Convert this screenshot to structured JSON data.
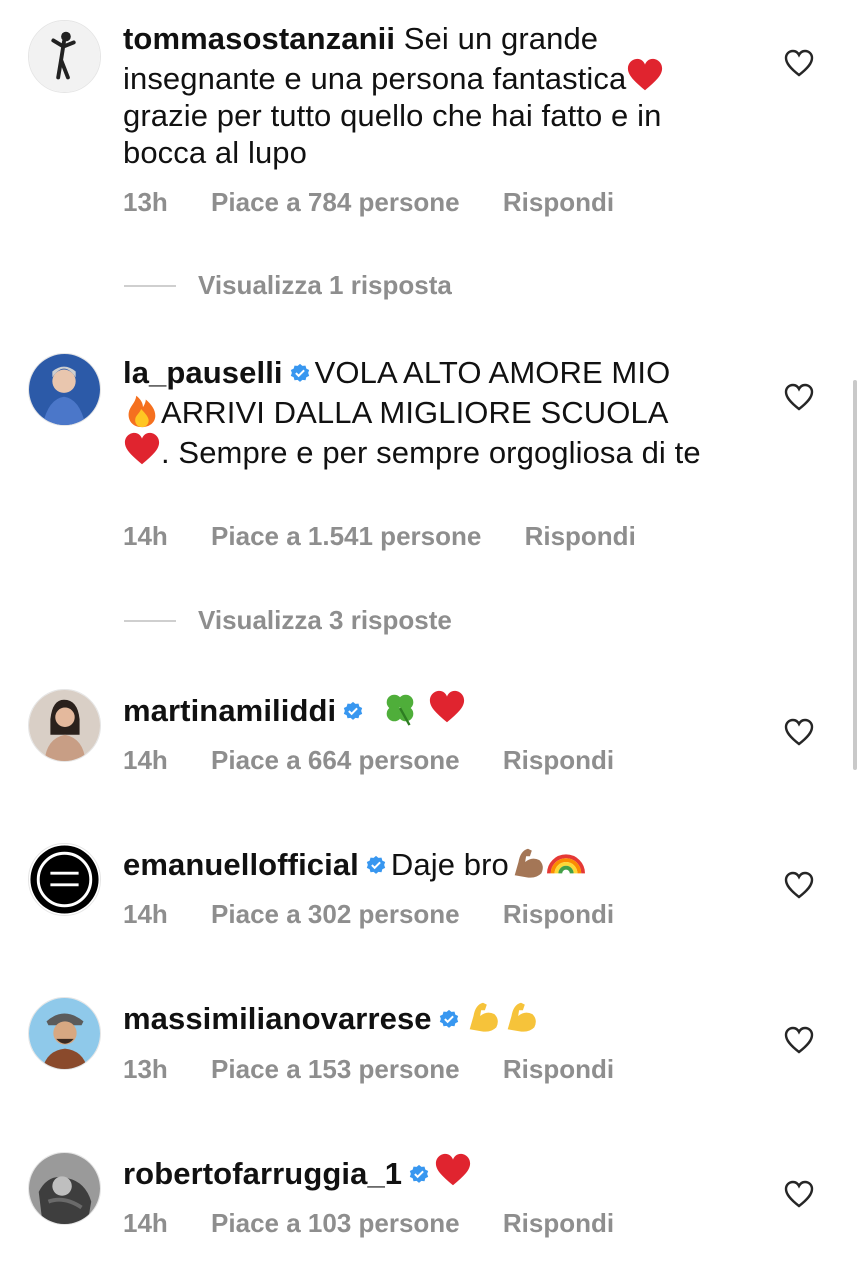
{
  "comments": [
    {
      "username": "tommasostanzanii",
      "verified": false,
      "text_before": "Sei un grande insegnante e una persona fantastica",
      "text_after": " grazie per tutto quello che hai fatto e in bocca al lupo",
      "time": "13h",
      "likes": "Piace a 784 persone",
      "reply": "Rispondi",
      "view_replies": "Visualizza 1 risposta",
      "avatar_icon": "person-silhouette"
    },
    {
      "username": "la_pauselli",
      "verified": true,
      "text_part1": "VOLA ALTO AMORE MIO",
      "text_part2": "ARRIVI DALLA MIGLIORE SCUOLA",
      "text_part3": ". Sempre e per sempre orgogliosa di te",
      "time": "14h",
      "likes": "Piace a 1.541 persone",
      "reply": "Rispondi",
      "view_replies": "Visualizza 3 risposte",
      "avatar_icon": "person-photo"
    },
    {
      "username": "martinamiliddi",
      "verified": true,
      "time": "14h",
      "likes": "Piace a 664 persone",
      "reply": "Rispondi",
      "avatar_icon": "person-photo"
    },
    {
      "username": "emanuellofficial",
      "verified": true,
      "text": "Daje bro",
      "time": "14h",
      "likes": "Piace a 302 persone",
      "reply": "Rispondi",
      "avatar_icon": "circle-logo"
    },
    {
      "username": "massimilianovarrese",
      "verified": true,
      "time": "13h",
      "likes": "Piace a 153 persone",
      "reply": "Rispondi",
      "avatar_icon": "person-photo"
    },
    {
      "username": "robertofarruggia_1",
      "verified": true,
      "time": "14h",
      "likes": "Piace a 103 persone",
      "reply": "Rispondi",
      "avatar_icon": "person-photo"
    }
  ],
  "colors": {
    "text": "#111111",
    "meta": "#8e8e8e",
    "verified": "#3897f0",
    "heart_red": "#e0242f"
  }
}
